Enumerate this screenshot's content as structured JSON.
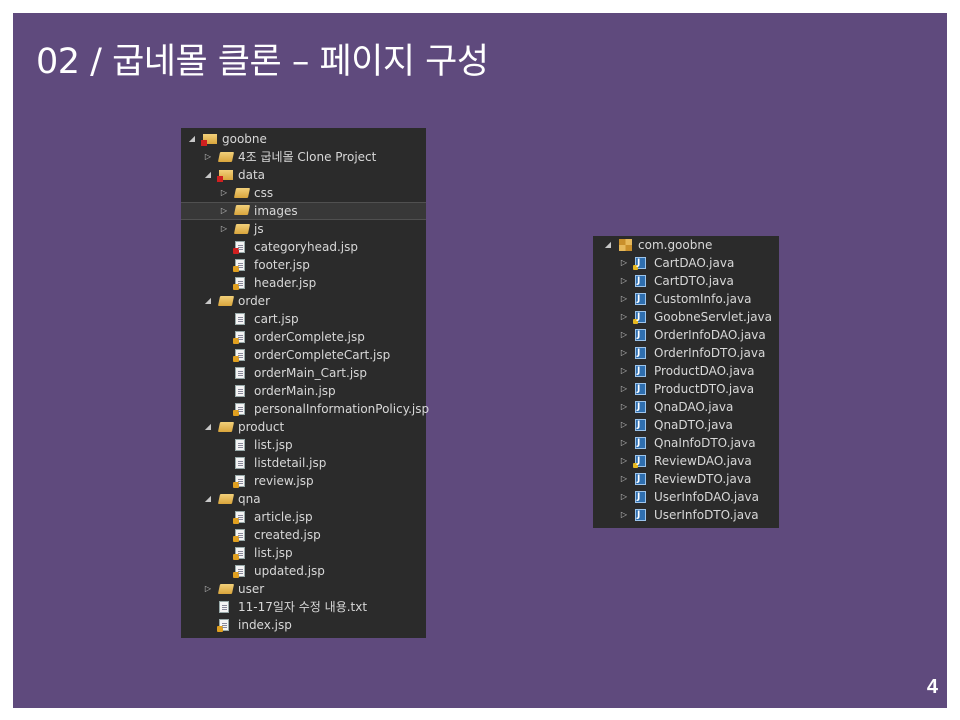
{
  "slide": {
    "title": "02 / 굽네몰 클론 – 페이지 구성",
    "page_number": "4",
    "background_color": "#5f4a7d"
  },
  "left_tree": {
    "items": [
      {
        "label": "goobne",
        "depth": 0,
        "arrow": "◢",
        "icon": "project-folder-icon"
      },
      {
        "label": "4조 굽네몰 Clone Project",
        "depth": 1,
        "arrow": "▷",
        "icon": "folder-icon"
      },
      {
        "label": "data",
        "depth": 1,
        "arrow": "◢",
        "icon": "error-folder-icon"
      },
      {
        "label": "css",
        "depth": 2,
        "arrow": "▷",
        "icon": "folder-icon"
      },
      {
        "label": "images",
        "depth": 2,
        "arrow": "▷",
        "icon": "folder-icon",
        "selected": true
      },
      {
        "label": "js",
        "depth": 2,
        "arrow": "▷",
        "icon": "folder-icon"
      },
      {
        "label": "categoryhead.jsp",
        "depth": 2,
        "arrow": "",
        "icon": "jsp-error-file-icon"
      },
      {
        "label": "footer.jsp",
        "depth": 2,
        "arrow": "",
        "icon": "jsp-file-icon"
      },
      {
        "label": "header.jsp",
        "depth": 2,
        "arrow": "",
        "icon": "jsp-file-icon"
      },
      {
        "label": "order",
        "depth": 1,
        "arrow": "◢",
        "icon": "folder-icon"
      },
      {
        "label": "cart.jsp",
        "depth": 2,
        "arrow": "",
        "icon": "file-icon"
      },
      {
        "label": "orderComplete.jsp",
        "depth": 2,
        "arrow": "",
        "icon": "jsp-file-icon"
      },
      {
        "label": "orderCompleteCart.jsp",
        "depth": 2,
        "arrow": "",
        "icon": "jsp-file-icon"
      },
      {
        "label": "orderMain_Cart.jsp",
        "depth": 2,
        "arrow": "",
        "icon": "file-icon"
      },
      {
        "label": "orderMain.jsp",
        "depth": 2,
        "arrow": "",
        "icon": "file-icon"
      },
      {
        "label": "personalInformationPolicy.jsp",
        "depth": 2,
        "arrow": "",
        "icon": "jsp-file-icon"
      },
      {
        "label": "product",
        "depth": 1,
        "arrow": "◢",
        "icon": "folder-icon"
      },
      {
        "label": "list.jsp",
        "depth": 2,
        "arrow": "",
        "icon": "file-icon"
      },
      {
        "label": "listdetail.jsp",
        "depth": 2,
        "arrow": "",
        "icon": "file-icon"
      },
      {
        "label": "review.jsp",
        "depth": 2,
        "arrow": "",
        "icon": "jsp-file-icon"
      },
      {
        "label": "qna",
        "depth": 1,
        "arrow": "◢",
        "icon": "folder-icon"
      },
      {
        "label": "article.jsp",
        "depth": 2,
        "arrow": "",
        "icon": "jsp-file-icon"
      },
      {
        "label": "created.jsp",
        "depth": 2,
        "arrow": "",
        "icon": "jsp-file-icon"
      },
      {
        "label": "list.jsp",
        "depth": 2,
        "arrow": "",
        "icon": "jsp-file-icon"
      },
      {
        "label": "updated.jsp",
        "depth": 2,
        "arrow": "",
        "icon": "jsp-file-icon"
      },
      {
        "label": "user",
        "depth": 1,
        "arrow": "▷",
        "icon": "folder-icon"
      },
      {
        "label": "11-17일자 수정 내용.txt",
        "depth": 1,
        "arrow": "",
        "icon": "text-file-icon"
      },
      {
        "label": "index.jsp",
        "depth": 1,
        "arrow": "",
        "icon": "jsp-file-icon"
      }
    ]
  },
  "right_tree": {
    "items": [
      {
        "label": "com.goobne",
        "depth": 0,
        "arrow": "◢",
        "icon": "package-icon"
      },
      {
        "label": "CartDAO.java",
        "depth": 1,
        "arrow": "▷",
        "icon": "java-warning-file-icon"
      },
      {
        "label": "CartDTO.java",
        "depth": 1,
        "arrow": "▷",
        "icon": "java-file-icon"
      },
      {
        "label": "CustomInfo.java",
        "depth": 1,
        "arrow": "▷",
        "icon": "java-file-icon"
      },
      {
        "label": "GoobneServlet.java",
        "depth": 1,
        "arrow": "▷",
        "icon": "java-warning-file-icon"
      },
      {
        "label": "OrderInfoDAO.java",
        "depth": 1,
        "arrow": "▷",
        "icon": "java-file-icon"
      },
      {
        "label": "OrderInfoDTO.java",
        "depth": 1,
        "arrow": "▷",
        "icon": "java-file-icon"
      },
      {
        "label": "ProductDAO.java",
        "depth": 1,
        "arrow": "▷",
        "icon": "java-file-icon"
      },
      {
        "label": "ProductDTO.java",
        "depth": 1,
        "arrow": "▷",
        "icon": "java-file-icon"
      },
      {
        "label": "QnaDAO.java",
        "depth": 1,
        "arrow": "▷",
        "icon": "java-file-icon"
      },
      {
        "label": "QnaDTO.java",
        "depth": 1,
        "arrow": "▷",
        "icon": "java-file-icon"
      },
      {
        "label": "QnaInfoDTO.java",
        "depth": 1,
        "arrow": "▷",
        "icon": "java-file-icon"
      },
      {
        "label": "ReviewDAO.java",
        "depth": 1,
        "arrow": "▷",
        "icon": "java-warning-file-icon"
      },
      {
        "label": "ReviewDTO.java",
        "depth": 1,
        "arrow": "▷",
        "icon": "java-file-icon"
      },
      {
        "label": "UserInfoDAO.java",
        "depth": 1,
        "arrow": "▷",
        "icon": "java-file-icon"
      },
      {
        "label": "UserInfoDTO.java",
        "depth": 1,
        "arrow": "▷",
        "icon": "java-file-icon"
      }
    ]
  }
}
